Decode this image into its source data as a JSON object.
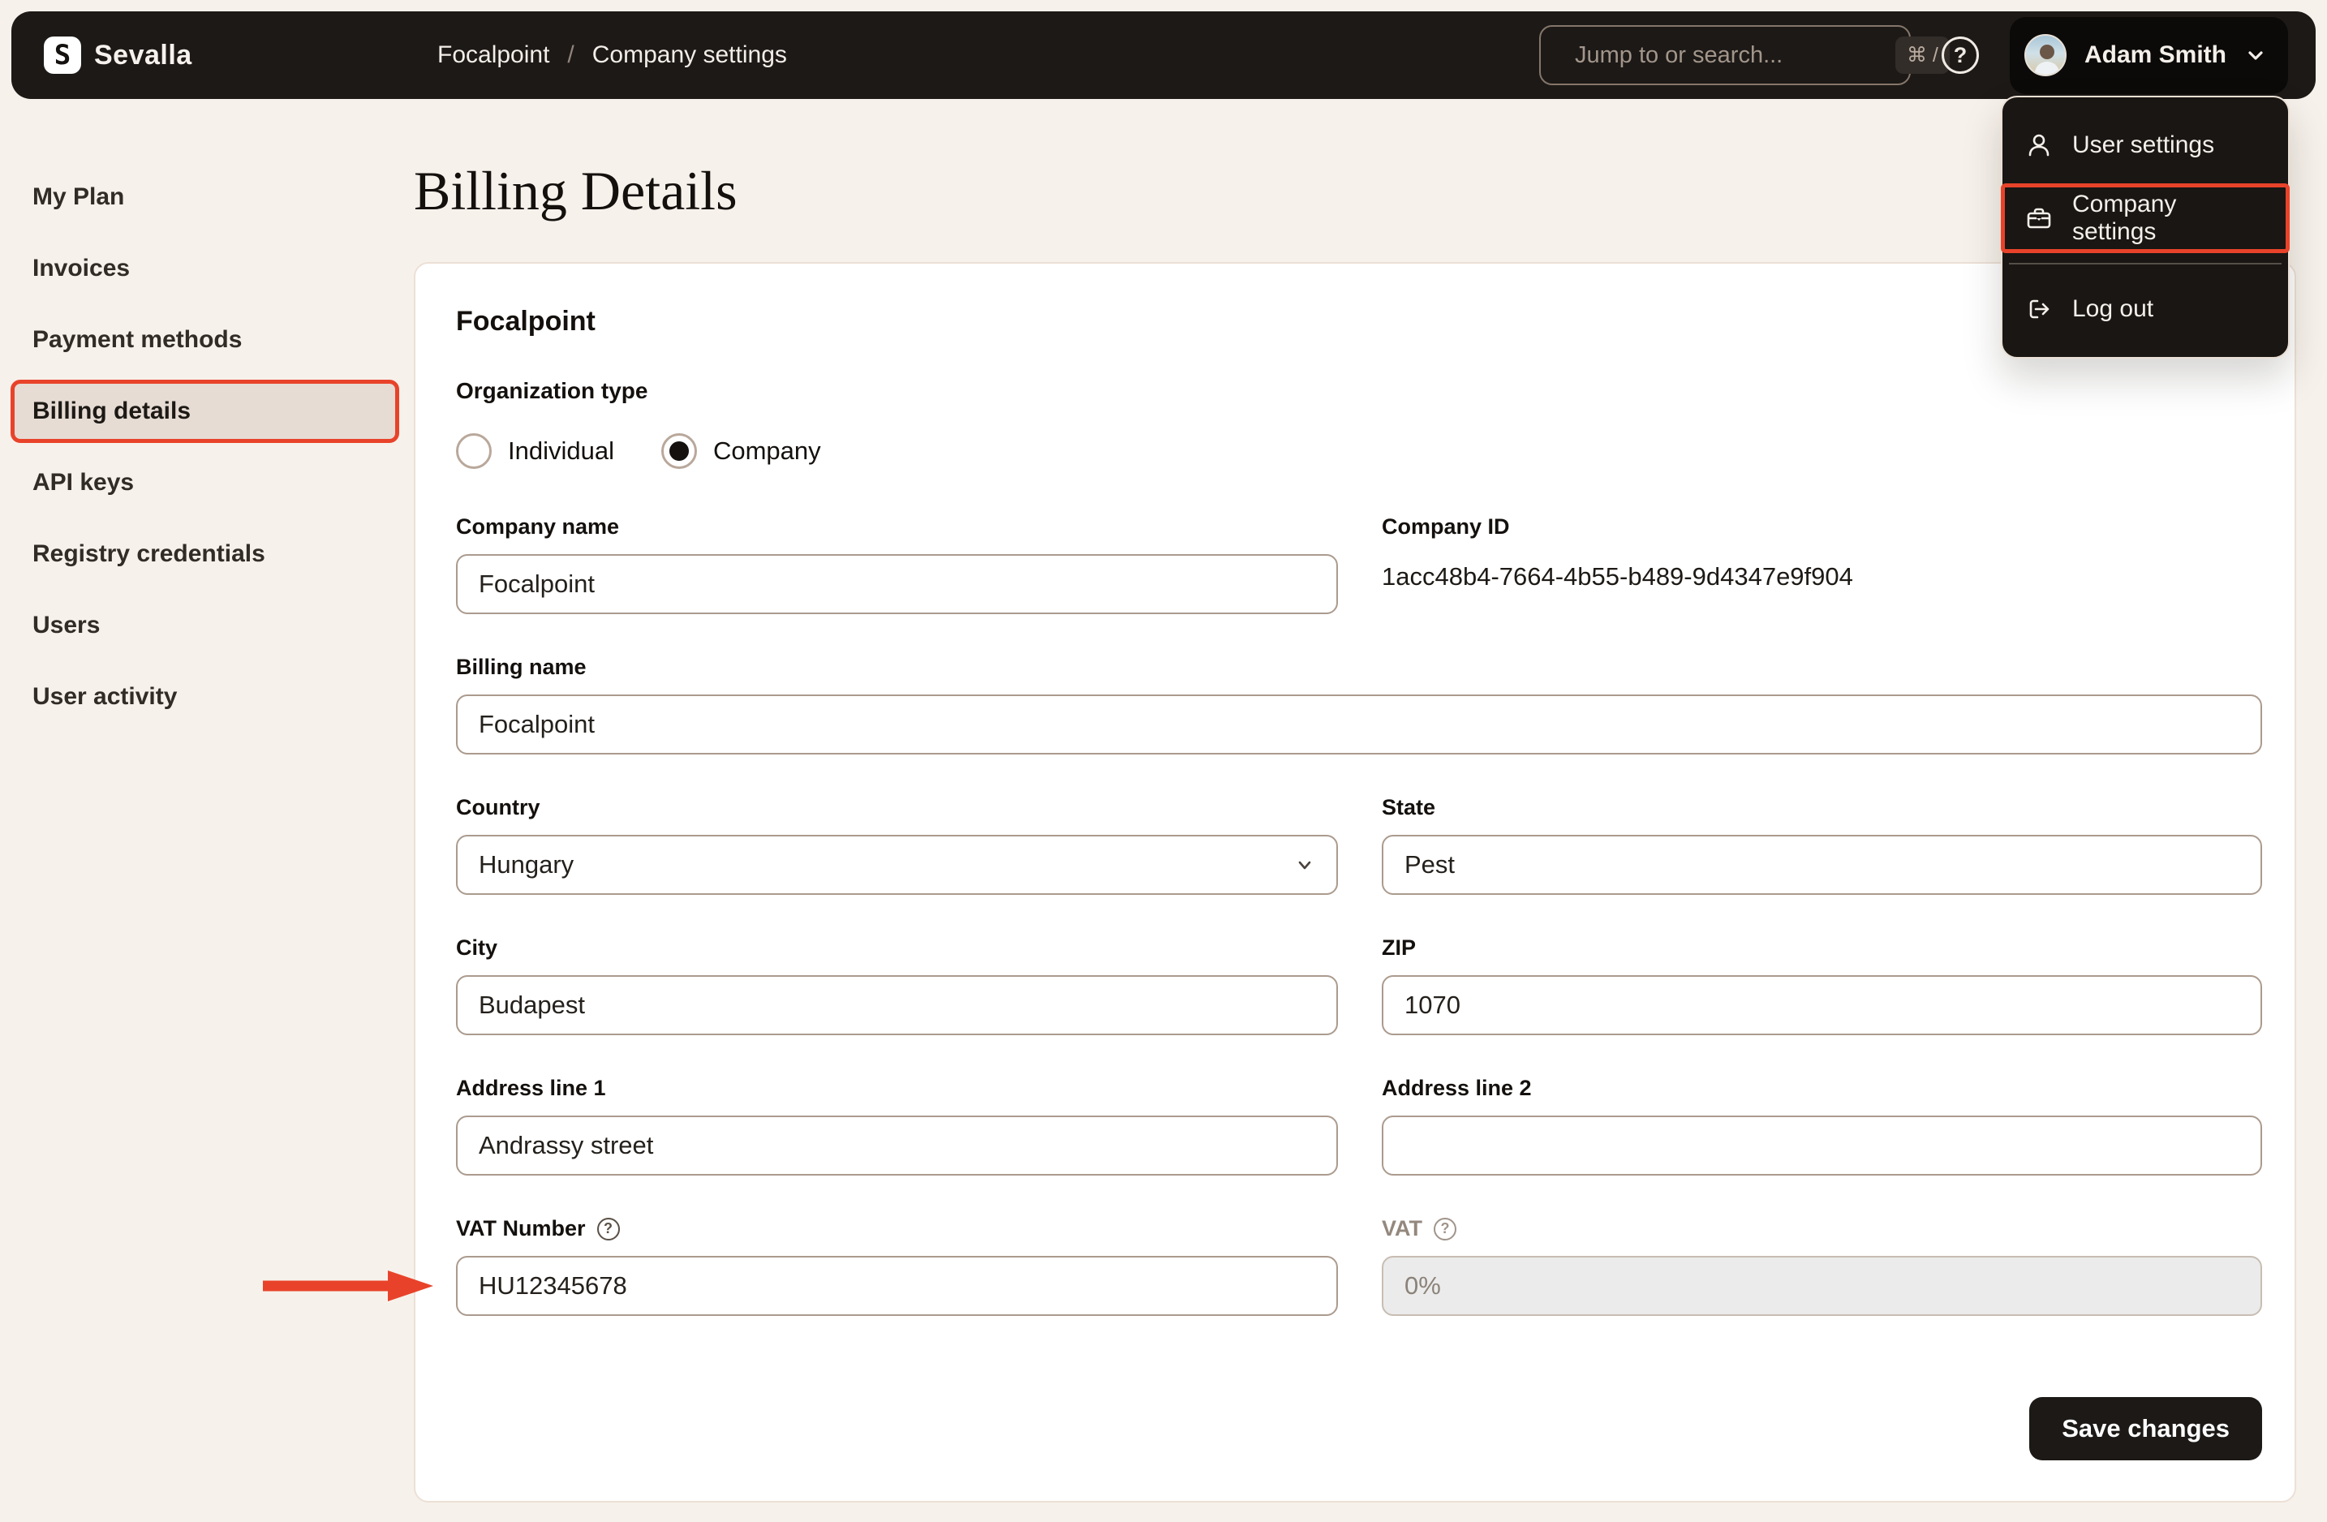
{
  "header": {
    "logo_letter": "S",
    "brand": "Sevalla",
    "breadcrumb": {
      "items": [
        "Focalpoint",
        "Company settings"
      ],
      "separator": "/"
    },
    "search": {
      "placeholder": "Jump to or search...",
      "shortcut": "⌘ /"
    },
    "user": {
      "name": "Adam Smith"
    }
  },
  "user_menu": {
    "items": [
      {
        "label": "User settings",
        "icon": "user-icon"
      },
      {
        "label": "Company settings",
        "icon": "briefcase-icon",
        "annotated": true
      },
      {
        "label": "Log out",
        "icon": "logout-icon"
      }
    ]
  },
  "sidebar": {
    "items": [
      {
        "label": "My Plan",
        "active": false
      },
      {
        "label": "Invoices",
        "active": false
      },
      {
        "label": "Payment methods",
        "active": false
      },
      {
        "label": "Billing details",
        "active": true
      },
      {
        "label": "API keys",
        "active": false
      },
      {
        "label": "Registry credentials",
        "active": false
      },
      {
        "label": "Users",
        "active": false
      },
      {
        "label": "User activity",
        "active": false
      }
    ]
  },
  "page": {
    "title": "Billing Details"
  },
  "form": {
    "heading": "Focalpoint",
    "organization_type": {
      "label": "Organization type",
      "options": [
        {
          "label": "Individual",
          "state": "unchecked"
        },
        {
          "label": "Company",
          "state": "checked"
        }
      ]
    },
    "fields": {
      "company_name": {
        "label": "Company name",
        "value": "Focalpoint"
      },
      "company_id": {
        "label": "Company ID",
        "value": "1acc48b4-7664-4b55-b489-9d4347e9f904"
      },
      "billing_name": {
        "label": "Billing name",
        "value": "Focalpoint"
      },
      "country": {
        "label": "Country",
        "value": "Hungary"
      },
      "state": {
        "label": "State",
        "value": "Pest"
      },
      "city": {
        "label": "City",
        "value": "Budapest"
      },
      "zip": {
        "label": "ZIP",
        "value": "1070"
      },
      "address1": {
        "label": "Address line 1",
        "value": "Andrassy street"
      },
      "address2": {
        "label": "Address line 2",
        "value": ""
      },
      "vat_number": {
        "label": "VAT Number",
        "value": "HU12345678"
      },
      "vat": {
        "label": "VAT",
        "value": "0%",
        "disabled": true
      }
    },
    "save_button": "Save changes"
  },
  "icons": {
    "question": "?"
  },
  "colors": {
    "annotation_red": "#e8432a",
    "topbar_bg": "#1c1917",
    "page_bg": "#f7f1eb",
    "active_item_bg": "#e6dcd4",
    "card_bg": "#ffffff"
  }
}
